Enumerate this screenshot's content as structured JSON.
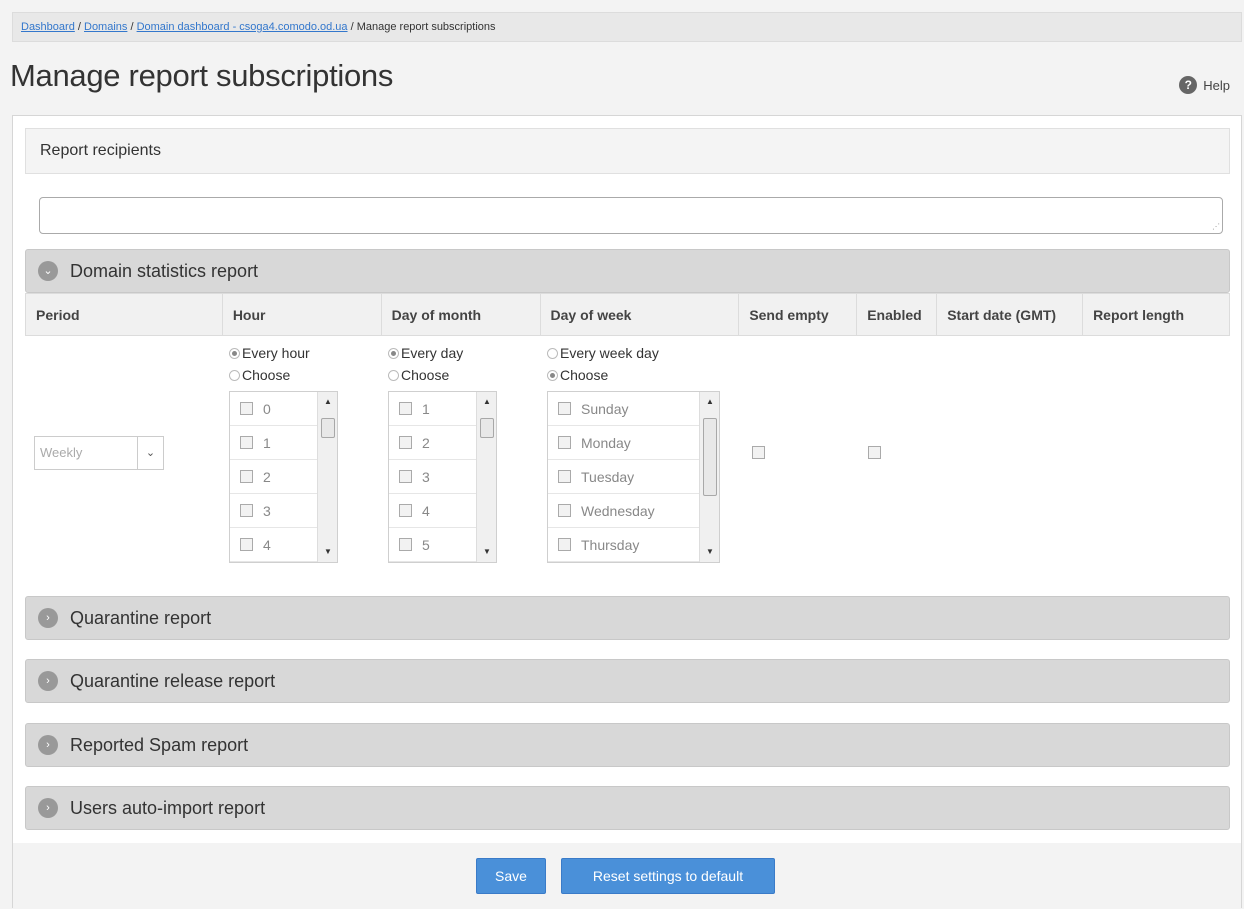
{
  "breadcrumb": {
    "links": [
      "Dashboard",
      "Domains",
      "Domain dashboard - csoga4.comodo.od.ua"
    ],
    "separator": " / ",
    "current": "Manage report subscriptions"
  },
  "page": {
    "title": "Manage report subscriptions",
    "help_label": "Help",
    "help_glyph": "?"
  },
  "recipients": {
    "label": "Report recipients",
    "value": "",
    "grip": "⋰"
  },
  "sections": {
    "expanded": "Domain statistics report",
    "collapsed": [
      "Quarantine report",
      "Quarantine release report",
      "Reported Spam report",
      "Users auto-import report"
    ]
  },
  "toggle_glyphs": {
    "expanded": "⌄",
    "collapsed": "›"
  },
  "table": {
    "headers": [
      "Period",
      "Hour",
      "Day of month",
      "Day of week",
      "Send empty",
      "Enabled",
      "Start date (GMT)",
      "Report length"
    ]
  },
  "period": {
    "selected": "Weekly",
    "arrow": "⌄"
  },
  "hour": {
    "radio_every": "Every hour",
    "radio_choose": "Choose",
    "selected": "every",
    "items": [
      "0",
      "1",
      "2",
      "3",
      "4"
    ]
  },
  "day_of_month": {
    "radio_every": "Every day",
    "radio_choose": "Choose",
    "selected": "every",
    "items": [
      "1",
      "2",
      "3",
      "4",
      "5"
    ]
  },
  "day_of_week": {
    "radio_every": "Every week day",
    "radio_choose": "Choose",
    "selected": "choose",
    "items": [
      "Sunday",
      "Monday",
      "Tuesday",
      "Wednesday",
      "Thursday"
    ]
  },
  "scroll": {
    "up": "▲",
    "down": "▼"
  },
  "buttons": {
    "save": "Save",
    "reset": "Reset settings to default"
  },
  "colors": {
    "accent": "#4a90d9",
    "link": "#3377cc",
    "section_bar": "#d8d8d8"
  }
}
